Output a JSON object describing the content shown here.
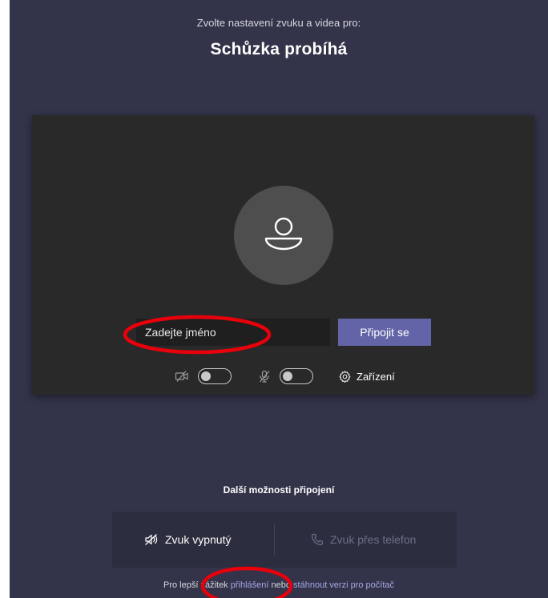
{
  "header": {
    "subtitle": "Zvolte nastavení zvuku a videa pro:",
    "title": "Schůzka probíhá"
  },
  "prejoin": {
    "name_placeholder": "Zadejte jméno",
    "join_label": "Připojit se",
    "camera_enabled": false,
    "mic_enabled": false,
    "devices_label": "Zařízení"
  },
  "more_options": {
    "title": "Další možnosti připojení",
    "audio_off_label": "Zvuk vypnutý",
    "phone_audio_label": "Zvuk přes telefon"
  },
  "footer": {
    "prefix": "Pro lepší zážitek ",
    "sign_in_link": "přihlášení",
    "middle": " nebo ",
    "download_link": "stáhnout verzi pro počítač"
  },
  "colors": {
    "background": "#33344a",
    "preview": "#292929",
    "accent": "#6264a7",
    "annotation": "#e8000b"
  },
  "icons": {
    "avatar": "person-icon",
    "camera": "camera-off-icon",
    "mic": "mic-off-icon",
    "devices": "gear-icon",
    "audio_off": "speaker-off-icon",
    "phone": "phone-icon"
  }
}
